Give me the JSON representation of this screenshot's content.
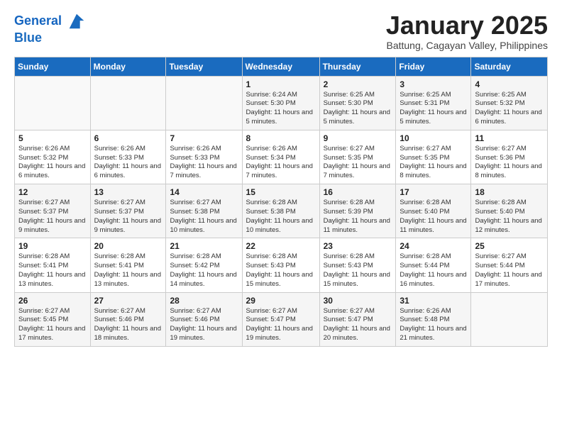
{
  "header": {
    "logo_line1": "General",
    "logo_line2": "Blue",
    "month": "January 2025",
    "location": "Battung, Cagayan Valley, Philippines"
  },
  "weekdays": [
    "Sunday",
    "Monday",
    "Tuesday",
    "Wednesday",
    "Thursday",
    "Friday",
    "Saturday"
  ],
  "weeks": [
    [
      {
        "day": "",
        "info": ""
      },
      {
        "day": "",
        "info": ""
      },
      {
        "day": "",
        "info": ""
      },
      {
        "day": "1",
        "info": "Sunrise: 6:24 AM\nSunset: 5:30 PM\nDaylight: 11 hours and 5 minutes."
      },
      {
        "day": "2",
        "info": "Sunrise: 6:25 AM\nSunset: 5:30 PM\nDaylight: 11 hours and 5 minutes."
      },
      {
        "day": "3",
        "info": "Sunrise: 6:25 AM\nSunset: 5:31 PM\nDaylight: 11 hours and 5 minutes."
      },
      {
        "day": "4",
        "info": "Sunrise: 6:25 AM\nSunset: 5:32 PM\nDaylight: 11 hours and 6 minutes."
      }
    ],
    [
      {
        "day": "5",
        "info": "Sunrise: 6:26 AM\nSunset: 5:32 PM\nDaylight: 11 hours and 6 minutes."
      },
      {
        "day": "6",
        "info": "Sunrise: 6:26 AM\nSunset: 5:33 PM\nDaylight: 11 hours and 6 minutes."
      },
      {
        "day": "7",
        "info": "Sunrise: 6:26 AM\nSunset: 5:33 PM\nDaylight: 11 hours and 7 minutes."
      },
      {
        "day": "8",
        "info": "Sunrise: 6:26 AM\nSunset: 5:34 PM\nDaylight: 11 hours and 7 minutes."
      },
      {
        "day": "9",
        "info": "Sunrise: 6:27 AM\nSunset: 5:35 PM\nDaylight: 11 hours and 7 minutes."
      },
      {
        "day": "10",
        "info": "Sunrise: 6:27 AM\nSunset: 5:35 PM\nDaylight: 11 hours and 8 minutes."
      },
      {
        "day": "11",
        "info": "Sunrise: 6:27 AM\nSunset: 5:36 PM\nDaylight: 11 hours and 8 minutes."
      }
    ],
    [
      {
        "day": "12",
        "info": "Sunrise: 6:27 AM\nSunset: 5:37 PM\nDaylight: 11 hours and 9 minutes."
      },
      {
        "day": "13",
        "info": "Sunrise: 6:27 AM\nSunset: 5:37 PM\nDaylight: 11 hours and 9 minutes."
      },
      {
        "day": "14",
        "info": "Sunrise: 6:27 AM\nSunset: 5:38 PM\nDaylight: 11 hours and 10 minutes."
      },
      {
        "day": "15",
        "info": "Sunrise: 6:28 AM\nSunset: 5:38 PM\nDaylight: 11 hours and 10 minutes."
      },
      {
        "day": "16",
        "info": "Sunrise: 6:28 AM\nSunset: 5:39 PM\nDaylight: 11 hours and 11 minutes."
      },
      {
        "day": "17",
        "info": "Sunrise: 6:28 AM\nSunset: 5:40 PM\nDaylight: 11 hours and 11 minutes."
      },
      {
        "day": "18",
        "info": "Sunrise: 6:28 AM\nSunset: 5:40 PM\nDaylight: 11 hours and 12 minutes."
      }
    ],
    [
      {
        "day": "19",
        "info": "Sunrise: 6:28 AM\nSunset: 5:41 PM\nDaylight: 11 hours and 13 minutes."
      },
      {
        "day": "20",
        "info": "Sunrise: 6:28 AM\nSunset: 5:41 PM\nDaylight: 11 hours and 13 minutes."
      },
      {
        "day": "21",
        "info": "Sunrise: 6:28 AM\nSunset: 5:42 PM\nDaylight: 11 hours and 14 minutes."
      },
      {
        "day": "22",
        "info": "Sunrise: 6:28 AM\nSunset: 5:43 PM\nDaylight: 11 hours and 15 minutes."
      },
      {
        "day": "23",
        "info": "Sunrise: 6:28 AM\nSunset: 5:43 PM\nDaylight: 11 hours and 15 minutes."
      },
      {
        "day": "24",
        "info": "Sunrise: 6:28 AM\nSunset: 5:44 PM\nDaylight: 11 hours and 16 minutes."
      },
      {
        "day": "25",
        "info": "Sunrise: 6:27 AM\nSunset: 5:44 PM\nDaylight: 11 hours and 17 minutes."
      }
    ],
    [
      {
        "day": "26",
        "info": "Sunrise: 6:27 AM\nSunset: 5:45 PM\nDaylight: 11 hours and 17 minutes."
      },
      {
        "day": "27",
        "info": "Sunrise: 6:27 AM\nSunset: 5:46 PM\nDaylight: 11 hours and 18 minutes."
      },
      {
        "day": "28",
        "info": "Sunrise: 6:27 AM\nSunset: 5:46 PM\nDaylight: 11 hours and 19 minutes."
      },
      {
        "day": "29",
        "info": "Sunrise: 6:27 AM\nSunset: 5:47 PM\nDaylight: 11 hours and 19 minutes."
      },
      {
        "day": "30",
        "info": "Sunrise: 6:27 AM\nSunset: 5:47 PM\nDaylight: 11 hours and 20 minutes."
      },
      {
        "day": "31",
        "info": "Sunrise: 6:26 AM\nSunset: 5:48 PM\nDaylight: 11 hours and 21 minutes."
      },
      {
        "day": "",
        "info": ""
      }
    ]
  ]
}
